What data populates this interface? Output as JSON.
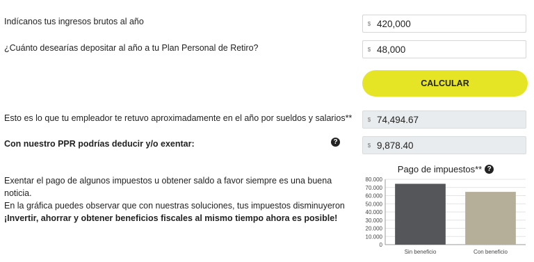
{
  "form": {
    "income_label": "Indícanos tus ingresos brutos al año",
    "income_currency": "$",
    "income_value": "420,000",
    "deposit_label": "¿Cuánto desearías depositar al año a tu Plan Personal de Retiro?",
    "deposit_currency": "$",
    "deposit_value": "48,000",
    "calculate_label": "CALCULAR"
  },
  "results": {
    "withheld_label": "Esto es lo que tu empleador te retuvo aproximadamente en el año por sueldos y salarios**",
    "withheld_currency": "$",
    "withheld_value": "74,494.67",
    "deduct_label": "Con nuestro PPR podrías deducir y/o exentar:",
    "deduct_currency": "$",
    "deduct_value": "9,878.40",
    "help_icon": "question-circle-icon"
  },
  "info": {
    "line1": "Exentar el pago de algunos impuestos u obtener saldo a favor siempre es una buena noticia.",
    "line2": "En la gráfica puedes observar que con nuestras soluciones, tus impuestos disminuyeron",
    "line3": "¡Invertir, ahorrar y obtener beneficios fiscales al mismo tiempo ahora es posible!"
  },
  "chart_data": {
    "type": "bar",
    "title": "Pago de impuestos**",
    "categories": [
      "Sin beneficio",
      "Con beneficio"
    ],
    "values": [
      74494.67,
      64616.27
    ],
    "colors": [
      "#545659",
      "#b5ae99"
    ],
    "ylim": [
      0,
      80000
    ],
    "yticks": [
      "0",
      "10.000",
      "20.000",
      "30.000",
      "40.000",
      "50.000",
      "60.000",
      "70.000",
      "80.000"
    ],
    "grid": true,
    "legend": "none"
  }
}
